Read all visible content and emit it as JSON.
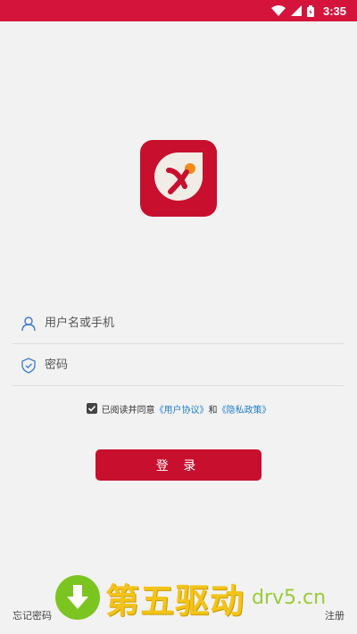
{
  "status_bar": {
    "time": "3:35"
  },
  "login": {
    "username_placeholder": "用户名或手机",
    "password_placeholder": "密码",
    "button_label": "登 录"
  },
  "agreement": {
    "prefix": "已阅读并同意",
    "user_agreement": "《用户协议》",
    "conjunction": "和",
    "privacy_policy": "《隐私政策》",
    "checked": true
  },
  "links": {
    "forgot_password": "忘记密码",
    "register": "注册"
  },
  "watermark": {
    "main": "第五驱动",
    "domain": "drv5.cn"
  },
  "colors": {
    "brand_red": "#c8102e",
    "link_blue": "#1f7fd0",
    "background": "#f2f2f2"
  }
}
